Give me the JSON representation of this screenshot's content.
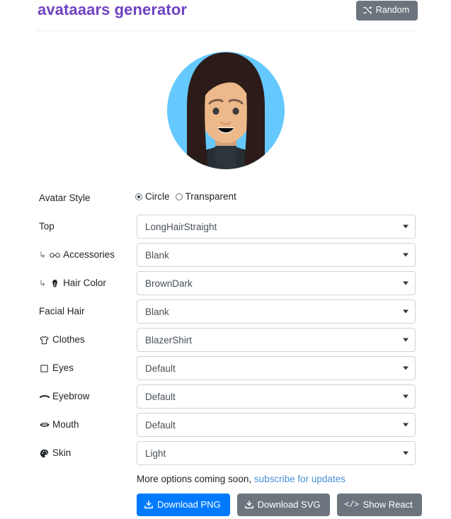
{
  "header": {
    "title": "avataaars generator",
    "random_label": "Random",
    "random_icon": "shuffle-icon"
  },
  "avatar": {
    "style": "Circle",
    "background_color": "#65C9FF",
    "skin_color": "#EDB98A",
    "hair_color": "#2C1B18",
    "clothes_color": "#262E33",
    "top": "LongHairStraight",
    "mouth": "Default",
    "eyes": "Default"
  },
  "avatar_style": {
    "label": "Avatar Style",
    "options": [
      "Circle",
      "Transparent"
    ],
    "selected": "Circle"
  },
  "fields": [
    {
      "label": "Top",
      "icon": "",
      "indent": false,
      "value": "LongHairStraight",
      "name": "top"
    },
    {
      "label": "Accessories",
      "icon": "glasses-icon",
      "indent": true,
      "value": "Blank",
      "name": "accessories"
    },
    {
      "label": "Hair Color",
      "icon": "hair-color-icon",
      "indent": true,
      "value": "BrownDark",
      "name": "hair-color"
    },
    {
      "label": "Facial Hair",
      "icon": "",
      "indent": false,
      "value": "Blank",
      "name": "facial-hair"
    },
    {
      "label": "Clothes",
      "icon": "tshirt-icon",
      "indent": false,
      "value": "BlazerShirt",
      "name": "clothes"
    },
    {
      "label": "Eyes",
      "icon": "eye-icon",
      "indent": false,
      "value": "Default",
      "name": "eyes"
    },
    {
      "label": "Eyebrow",
      "icon": "eyebrow-icon",
      "indent": false,
      "value": "Default",
      "name": "eyebrow"
    },
    {
      "label": "Mouth",
      "icon": "mouth-icon",
      "indent": false,
      "value": "Default",
      "name": "mouth"
    },
    {
      "label": "Skin",
      "icon": "palette-icon",
      "indent": false,
      "value": "Light",
      "name": "skin"
    }
  ],
  "footer": {
    "note_text": "More options coming soon, ",
    "note_link": "subscribe for updates",
    "buttons": [
      {
        "label": "Download PNG",
        "icon": "download-icon",
        "style": "primary"
      },
      {
        "label": "Download SVG",
        "icon": "download-icon",
        "style": "secondary"
      },
      {
        "label": "Show React",
        "icon": "code-icon",
        "style": "secondary"
      }
    ]
  },
  "colors": {
    "brand": "#6f42c1",
    "primary": "#007bff",
    "secondary": "#6c757d",
    "link": "#4a90d9"
  }
}
